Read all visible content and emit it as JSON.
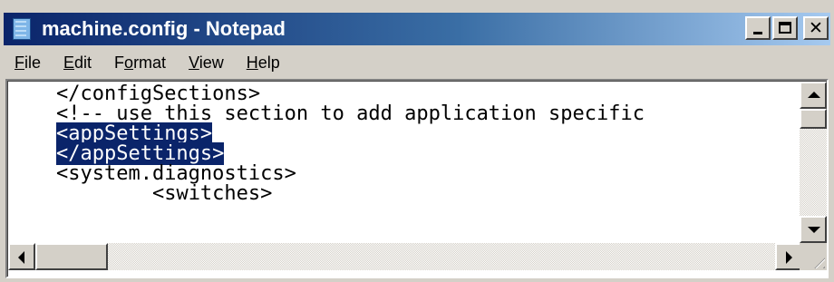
{
  "window": {
    "title": "machine.config - Notepad"
  },
  "menu": [
    {
      "accel": "F",
      "rest": "ile"
    },
    {
      "accel": "E",
      "rest": "dit"
    },
    {
      "pre": "F",
      "accel": "o",
      "rest": "rmat"
    },
    {
      "accel": "V",
      "rest": "iew"
    },
    {
      "accel": "H",
      "rest": "elp"
    }
  ],
  "editor": {
    "lines": [
      {
        "indent": "    ",
        "text": "</configSections>",
        "selected": false
      },
      {
        "indent": "    ",
        "text": "<!-- use this section to add application specific",
        "selected": false
      },
      {
        "indent": "    ",
        "text": "<appSettings>",
        "selected": true
      },
      {
        "indent": "    ",
        "text": "</appSettings>",
        "selected": true
      },
      {
        "indent": "    ",
        "text": "<system.diagnostics>",
        "selected": false
      },
      {
        "indent": "            ",
        "text": "<switches>",
        "selected": false
      }
    ],
    "selection_color": "#0a246a"
  },
  "icons": {
    "app": "notepad-icon",
    "minimize": "minimize-icon",
    "maximize": "maximize-icon",
    "close": "close-icon"
  },
  "colors": {
    "titlebar_start": "#0a246a",
    "titlebar_end": "#a6caf0",
    "chrome": "#d4d0c8"
  }
}
